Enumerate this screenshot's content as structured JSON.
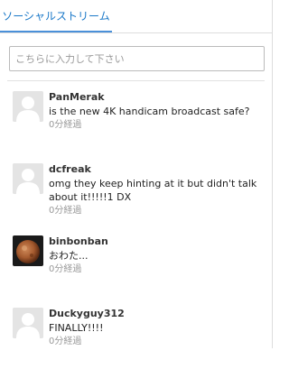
{
  "tabs": [
    {
      "label": "ソーシャルストリーム"
    }
  ],
  "search": {
    "placeholder": "こちらに入力して下さい"
  },
  "posts": [
    {
      "username": "PanMerak",
      "message": "is the new 4K handicam broadcast safe?",
      "time": "0分経過",
      "avatar": "default-avatar"
    },
    {
      "username": "dcfreak",
      "message": "omg they keep hinting at it but didn't talk about it!!!!!1 DX",
      "time": "0分経過",
      "avatar": "default-avatar"
    },
    {
      "username": "binbonban",
      "message": "おわた...",
      "time": "0分経過",
      "avatar": "photo-avatar"
    },
    {
      "username": "Duckyguy312",
      "message": "FINALLY!!!!",
      "time": "0分経過",
      "avatar": "default-avatar"
    }
  ],
  "colors": {
    "accent": "#4a90d9",
    "tab_text": "#1a78c8"
  }
}
